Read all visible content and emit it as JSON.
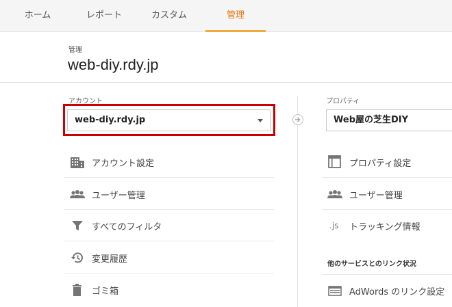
{
  "nav": {
    "tabs": [
      {
        "label": "ホーム"
      },
      {
        "label": "レポート"
      },
      {
        "label": "カスタム"
      },
      {
        "label": "管理"
      }
    ],
    "active_color": "#e8710a"
  },
  "header": {
    "breadcrumb": "管理",
    "title": "web-diy.rdy.jp"
  },
  "account": {
    "label": "アカウント",
    "selected": "web-diy.rdy.jp",
    "menu": [
      {
        "label": "アカウント設定",
        "icon": "building-icon"
      },
      {
        "label": "ユーザー管理",
        "icon": "users-icon"
      },
      {
        "label": "すべてのフィルタ",
        "icon": "filter-icon"
      },
      {
        "label": "変更履歴",
        "icon": "history-icon"
      },
      {
        "label": "ゴミ箱",
        "icon": "trash-icon"
      }
    ]
  },
  "property": {
    "label": "プロパティ",
    "selected": "Web屋の芝生DIY",
    "menu": [
      {
        "label": "プロパティ設定",
        "icon": "window-icon"
      },
      {
        "label": "ユーザー管理",
        "icon": "users-icon"
      },
      {
        "label": "トラッキング情報",
        "icon": "js-icon"
      }
    ],
    "section_heading": "他のサービスとのリンク状況",
    "links": [
      {
        "label": "AdWords のリンク設定",
        "icon": "adwords-icon"
      }
    ]
  },
  "colors": {
    "highlight": "#cc0000",
    "tab_underline": "#f2a93b"
  }
}
